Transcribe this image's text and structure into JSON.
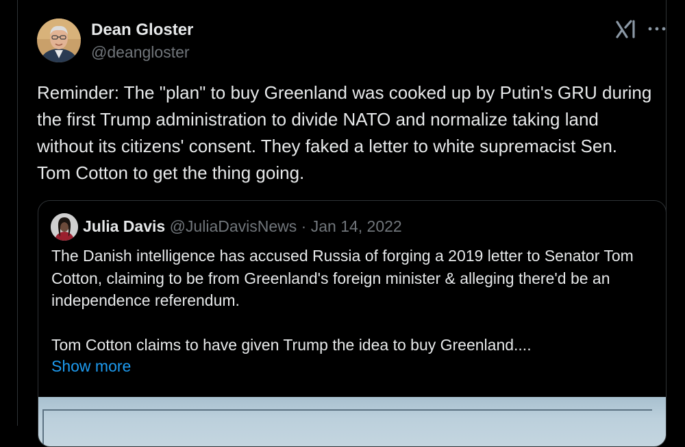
{
  "tweet": {
    "author_name": "Dean Gloster",
    "author_handle": "@deangloster",
    "text": "Reminder: The \"plan\" to buy Greenland was cooked up by Putin's GRU during the first Trump administration to divide NATO and normalize taking land without its citizens' consent. They faked a letter to white supremacist Sen. Tom Cotton to get the thing going."
  },
  "header_icons": {
    "grok": "grok-icon",
    "more": "more-icon"
  },
  "quote": {
    "author_name": "Julia Davis",
    "author_handle": "@JuliaDavisNews",
    "separator": " · ",
    "date": "Jan 14, 2022",
    "text_paragraph_1": "The Danish intelligence has accused Russia of forging a 2019 letter to Senator Tom Cotton, claiming to be from Greenland's foreign minister & alleging there'd be an independence referendum.",
    "text_paragraph_2": "Tom Cotton claims to have given Trump the idea to buy Greenland....",
    "show_more": "Show more"
  },
  "colors": {
    "background": "#000000",
    "text_primary": "#e7e9ea",
    "text_secondary": "#71767b",
    "link": "#1d9bf0",
    "border": "#2f3336"
  }
}
